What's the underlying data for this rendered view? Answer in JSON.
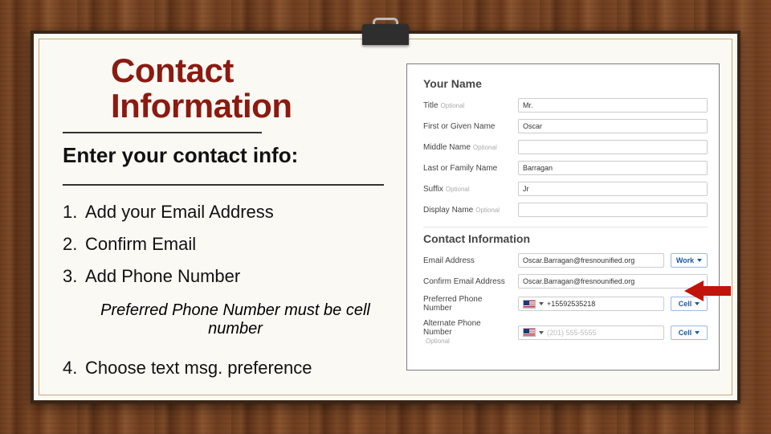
{
  "title_line1": "Contact",
  "title_line2": "Information",
  "subtitle": "Enter your contact info:",
  "steps": {
    "s1": "Add your Email Address",
    "s2": "Confirm Email",
    "s3": "Add Phone Number",
    "s4": "Choose text msg. preference"
  },
  "note": "Preferred Phone Number must be cell number",
  "form": {
    "section_name": "Your Name",
    "section_contact": "Contact Information",
    "optional": "Optional",
    "labels": {
      "title": "Title",
      "first": "First or Given Name",
      "middle": "Middle Name",
      "last": "Last or Family Name",
      "suffix": "Suffix",
      "display": "Display Name",
      "email": "Email Address",
      "confirm_email": "Confirm Email Address",
      "pref_phone": "Preferred Phone Number",
      "alt_phone": "Alternate Phone Number"
    },
    "values": {
      "title": "Mr.",
      "first": "Oscar",
      "middle": "",
      "last": "Barragan",
      "suffix": "Jr",
      "display": "",
      "email": "Oscar.Barragan@fresnounified.org",
      "confirm_email": "Oscar.Barragan@fresnounified.org",
      "pref_phone": "+15592535218",
      "alt_phone_placeholder": "(201) 555-5555"
    },
    "types": {
      "email": "Work",
      "pref_phone": "Cell",
      "alt_phone": "Cell"
    }
  }
}
